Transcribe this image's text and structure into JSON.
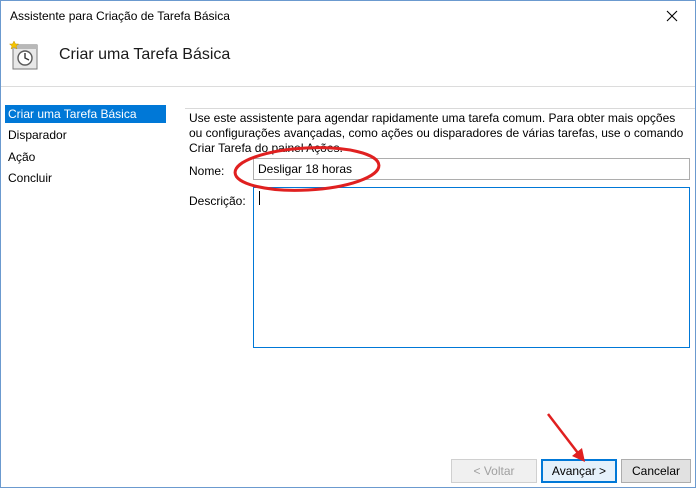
{
  "window": {
    "title": "Assistente para Criação de Tarefa Básica",
    "close_icon": "close-icon"
  },
  "header": {
    "title": "Criar uma Tarefa Básica",
    "icon": "scheduled-task-icon"
  },
  "sidebar": {
    "items": [
      {
        "label": "Criar uma Tarefa Básica",
        "active": true
      },
      {
        "label": "Disparador",
        "active": false
      },
      {
        "label": "Ação",
        "active": false
      },
      {
        "label": "Concluir",
        "active": false
      }
    ]
  },
  "main": {
    "intro": "Use este assistente para agendar rapidamente uma tarefa comum. Para obter mais opções ou configurações avançadas, como ações ou disparadores de várias tarefas, use o comando Criar Tarefa do painel Ações.",
    "name_label": "Nome:",
    "name_value": "Desligar 18 horas",
    "description_label": "Descrição:",
    "description_value": ""
  },
  "buttons": {
    "back": "< Voltar",
    "next": "Avançar >",
    "cancel": "Cancelar"
  },
  "colors": {
    "accent": "#0078d7",
    "annotation": "#e02020"
  }
}
